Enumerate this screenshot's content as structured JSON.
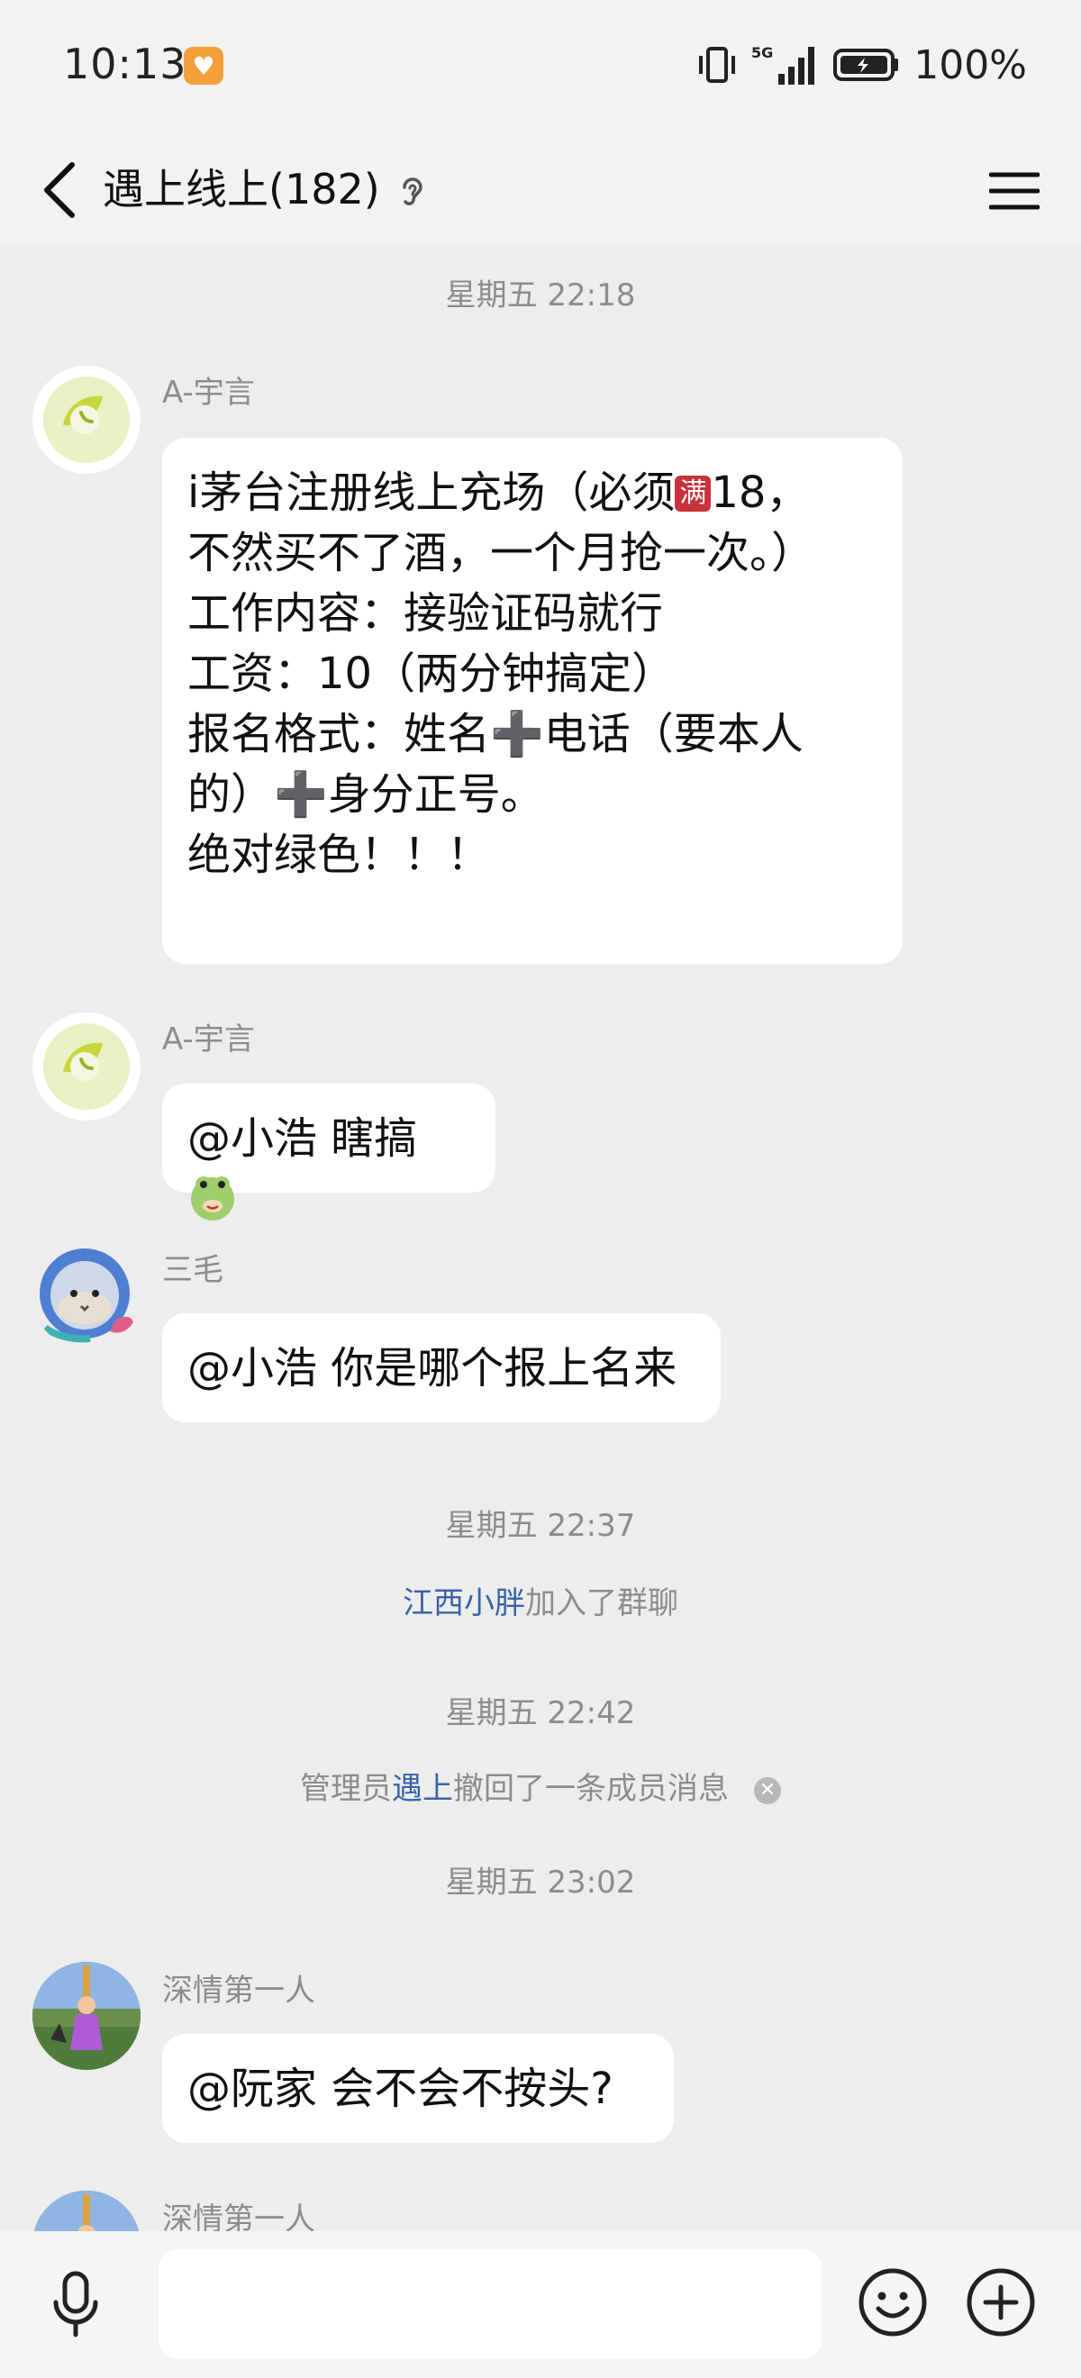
{
  "status": {
    "time": "10:13",
    "battery": "100%",
    "network": "5G"
  },
  "header": {
    "title": "遇上线上(182)"
  },
  "messages": {
    "t1": "星期五 22:18",
    "m1": {
      "sender": "A-宇言",
      "lines": [
        "i茅台注册线上充场（必须",
        "满",
        "18，",
        "不然买不了酒，一个月抢一次。）",
        "工作内容：接验证码就行",
        "工资：10（两分钟搞定）",
        "报名格式：姓名➕电话（要本人",
        "的）➕身分正号。",
        "绝对绿色！！！"
      ]
    },
    "m2": {
      "sender": "A-宇言",
      "text": "@小浩 瞎搞"
    },
    "m3": {
      "sender": "三毛",
      "text": "@小浩 你是哪个报上名来"
    },
    "t2": "星期五 22:37",
    "sys1": {
      "name": "江西小胖",
      "suffix": "加入了群聊"
    },
    "t3": "星期五 22:42",
    "sys2": {
      "prefix": "管理员",
      "name": "遇上",
      "suffix": "撤回了一条成员消息"
    },
    "t4": "星期五 23:02",
    "m4": {
      "sender": "深情第一人",
      "text": "@阮家 会不会不按头?"
    },
    "m5": {
      "sender": "深情第一人"
    }
  },
  "input": {
    "placeholder": ""
  }
}
